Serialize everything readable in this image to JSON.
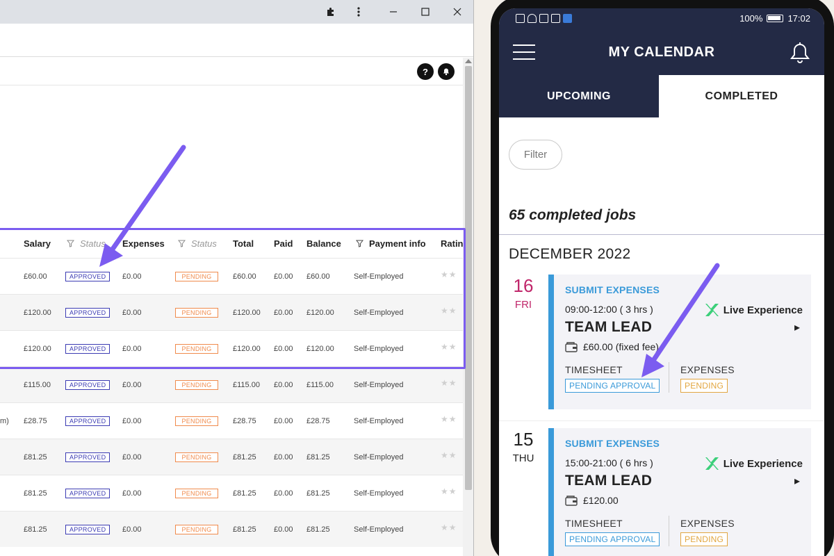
{
  "browser": {
    "icons": [
      "puzzle-icon",
      "more-vert-icon",
      "minimize-icon",
      "maximize-icon",
      "close-icon",
      "help-icon",
      "bell-icon"
    ],
    "help_label": "?",
    "columns": {
      "salary": "Salary",
      "status1": "Status",
      "expenses": "Expenses",
      "status2": "Status",
      "total": "Total",
      "paid": "Paid",
      "balance": "Balance",
      "payment_info": "Payment info",
      "rating": "Ratin"
    },
    "rows": [
      {
        "prefix": "",
        "salary": "£60.00",
        "status1": "APPROVED",
        "expenses": "£0.00",
        "status2": "PENDING",
        "total": "£60.00",
        "paid": "£0.00",
        "balance": "£60.00",
        "payment": "Self-Employed",
        "stars": "★★"
      },
      {
        "prefix": "",
        "salary": "£120.00",
        "status1": "APPROVED",
        "expenses": "£0.00",
        "status2": "PENDING",
        "total": "£120.00",
        "paid": "£0.00",
        "balance": "£120.00",
        "payment": "Self-Employed",
        "stars": "★★"
      },
      {
        "prefix": "",
        "salary": "£120.00",
        "status1": "APPROVED",
        "expenses": "£0.00",
        "status2": "PENDING",
        "total": "£120.00",
        "paid": "£0.00",
        "balance": "£120.00",
        "payment": "Self-Employed",
        "stars": "★★"
      },
      {
        "prefix": "",
        "salary": "£115.00",
        "status1": "APPROVED",
        "expenses": "£0.00",
        "status2": "PENDING",
        "total": "£115.00",
        "paid": "£0.00",
        "balance": "£115.00",
        "payment": "Self-Employed",
        "stars": "★★"
      },
      {
        "prefix": "m)",
        "salary": "£28.75",
        "status1": "APPROVED",
        "expenses": "£0.00",
        "status2": "PENDING",
        "total": "£28.75",
        "paid": "£0.00",
        "balance": "£28.75",
        "payment": "Self-Employed",
        "stars": "★★"
      },
      {
        "prefix": "",
        "salary": "£81.25",
        "status1": "APPROVED",
        "expenses": "£0.00",
        "status2": "PENDING",
        "total": "£81.25",
        "paid": "£0.00",
        "balance": "£81.25",
        "payment": "Self-Employed",
        "stars": "★★"
      },
      {
        "prefix": "",
        "salary": "£81.25",
        "status1": "APPROVED",
        "expenses": "£0.00",
        "status2": "PENDING",
        "total": "£81.25",
        "paid": "£0.00",
        "balance": "£81.25",
        "payment": "Self-Employed",
        "stars": "★★"
      },
      {
        "prefix": "",
        "salary": "£81.25",
        "status1": "APPROVED",
        "expenses": "£0.00",
        "status2": "PENDING",
        "total": "£81.25",
        "paid": "£0.00",
        "balance": "£81.25",
        "payment": "Self-Employed",
        "stars": "★★"
      }
    ]
  },
  "phone": {
    "status_bar": {
      "battery": "100%",
      "time": "17:02"
    },
    "header_title": "MY CALENDAR",
    "tabs": {
      "upcoming": "UPCOMING",
      "completed": "COMPLETED"
    },
    "filter_label": "Filter",
    "jobs_count": "65 completed jobs",
    "month": "DECEMBER 2022",
    "jobs": [
      {
        "day_num": "16",
        "day_name": "FRI",
        "day_color": "#c0266a",
        "submit_label": "SUBMIT EXPENSES",
        "time": "09:00-12:00 ( 3 hrs )",
        "company": "Live Experience",
        "role": "TEAM LEAD",
        "fee": "£60.00 (fixed fee)",
        "timesheet_label": "TIMESHEET",
        "timesheet_status": "PENDING APPROVAL",
        "expenses_label": "EXPENSES",
        "expenses_status": "PENDING"
      },
      {
        "day_num": "15",
        "day_name": "THU",
        "day_color": "#222222",
        "submit_label": "SUBMIT EXPENSES",
        "time": "15:00-21:00 ( 6 hrs )",
        "company": "Live Experience",
        "role": "TEAM LEAD",
        "fee": "£120.00",
        "timesheet_label": "TIMESHEET",
        "timesheet_status": "PENDING APPROVAL",
        "expenses_label": "EXPENSES",
        "expenses_status": "PENDING"
      }
    ]
  },
  "colors": {
    "navy": "#232a45",
    "accent_blue": "#3a9ad9",
    "approved": "#3b3bb3",
    "pending_orange": "#f08a4b",
    "pending_gold": "#e2a640",
    "highlight_purple": "#7b5cf0"
  }
}
